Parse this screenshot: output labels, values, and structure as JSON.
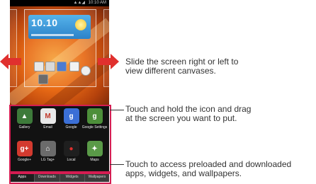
{
  "status_bar": {
    "signal": "▲▲◢",
    "time": "10:10 AM"
  },
  "widget": {
    "time": "10.10"
  },
  "callouts": {
    "canvases": {
      "line1": "Slide the screen right or left to",
      "line2": "view different canvases."
    },
    "drag": {
      "line1": "Touch and hold the icon and drag",
      "line2": "at the screen you want to put."
    },
    "tabs": {
      "line1": "Touch to access preloaded and downloaded",
      "line2": "apps, widgets, and wallpapers."
    }
  },
  "apps": [
    {
      "label": "Gallery",
      "icon": "gallery-icon",
      "color": "#3d7a3a"
    },
    {
      "label": "Email",
      "icon": "email-icon",
      "color": "#e8e8e8"
    },
    {
      "label": "Google",
      "icon": "google-icon",
      "color": "#3b6fd6"
    },
    {
      "label": "Google Settings",
      "icon": "google-settings-icon",
      "color": "#4d8f3a"
    },
    {
      "label": "Google+",
      "icon": "google-plus-icon",
      "color": "#d33a2f"
    },
    {
      "label": "LG Tag+",
      "icon": "lg-tag-icon",
      "color": "#6b6b6b"
    },
    {
      "label": "Local",
      "icon": "local-icon",
      "color": "#b9332c"
    },
    {
      "label": "Maps",
      "icon": "maps-icon",
      "color": "#5a9a48"
    }
  ],
  "tabs": [
    "Apps",
    "Downloads",
    "Widgets",
    "Wallpapers"
  ],
  "colors": {
    "arrow": "#e0302e",
    "highlight": "#d41d52"
  }
}
